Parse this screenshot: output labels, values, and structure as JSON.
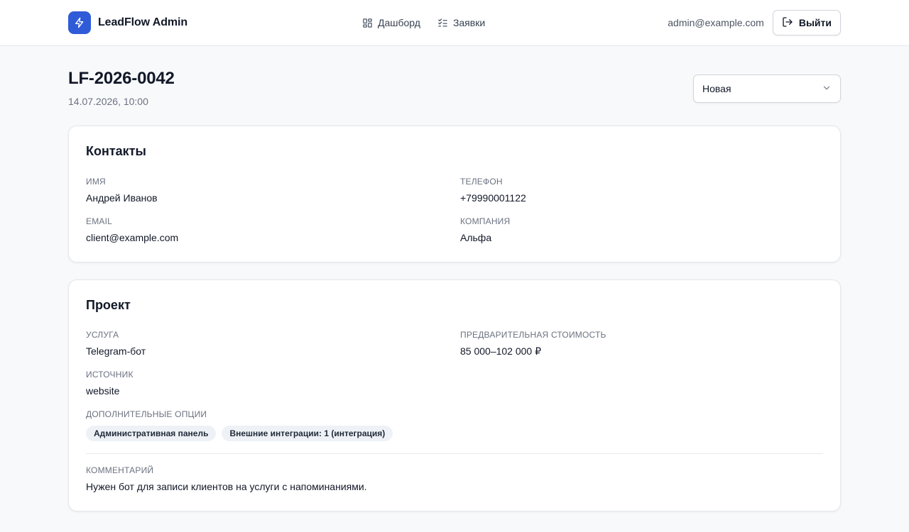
{
  "app": {
    "name": "LeadFlow Admin"
  },
  "nav": {
    "items": [
      {
        "label": "Дашборд",
        "icon": "dashboard-grid-icon"
      },
      {
        "label": "Заявки",
        "icon": "checklist-icon"
      }
    ]
  },
  "user": {
    "email": "admin@example.com",
    "logout_label": "Выйти"
  },
  "lead": {
    "id": "LF-2026-0042",
    "date": "14.07.2026, 10:00",
    "status": "Новая"
  },
  "contacts": {
    "title": "Контакты",
    "name": {
      "label": "ИМЯ",
      "value": "Андрей Иванов"
    },
    "phone": {
      "label": "ТЕЛЕФОН",
      "value": "+79990001122"
    },
    "email": {
      "label": "EMAIL",
      "value": "client@example.com"
    },
    "company": {
      "label": "КОМПАНИЯ",
      "value": "Альфа"
    }
  },
  "project": {
    "title": "Проект",
    "service": {
      "label": "УСЛУГА",
      "value": "Telegram-бот"
    },
    "price": {
      "label": "ПРЕДВАРИТЕЛЬНАЯ СТОИМОСТЬ",
      "value": "85 000–102 000 ₽"
    },
    "source": {
      "label": "ИСТОЧНИК",
      "value": "website"
    },
    "options_label": "ДОПОЛНИТЕЛЬНЫЕ ОПЦИИ",
    "options": [
      "Административная панель",
      "Внешние интеграции: 1 (интеграция)"
    ],
    "comment": {
      "label": "КОММЕНТАРИЙ",
      "value": "Нужен бот для записи клиентов на услуги с напоминаниями."
    }
  },
  "colors": {
    "brand": "#2f5bd8",
    "text": "#111827",
    "muted": "#6b7280",
    "chip_bg": "#eef2f7",
    "page_bg": "#f8f9fb"
  }
}
